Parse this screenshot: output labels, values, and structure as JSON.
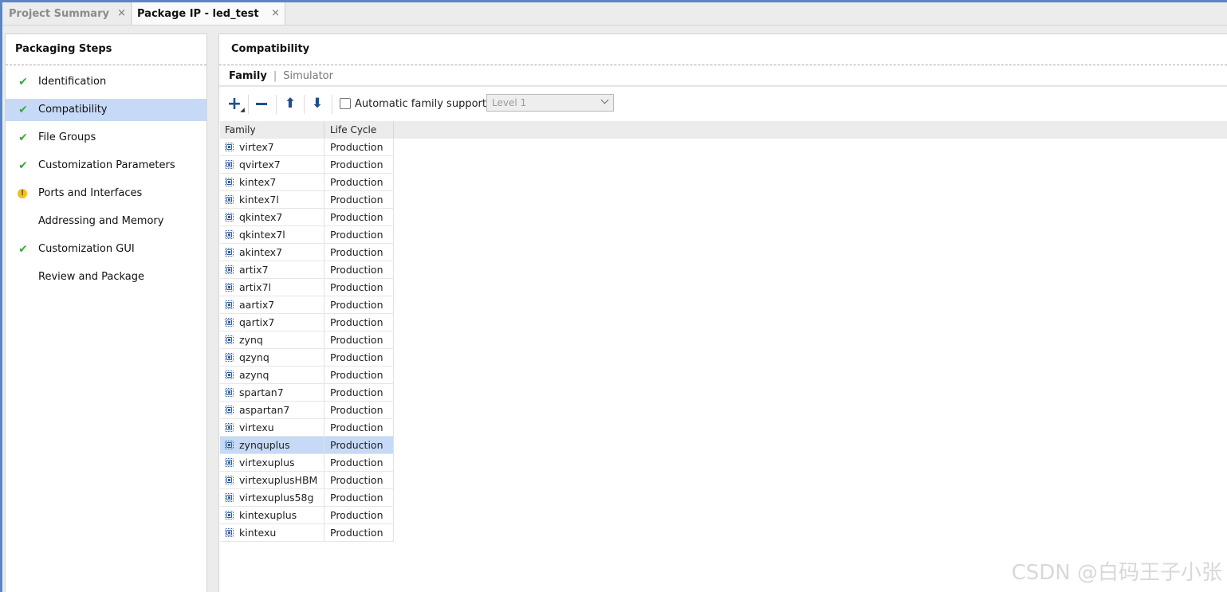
{
  "tabs": [
    {
      "label": "Project Summary",
      "active": false
    },
    {
      "label": "Package IP - led_test",
      "active": true
    }
  ],
  "tab_close_glyph": "×",
  "left_panel": {
    "title": "Packaging Steps",
    "steps": [
      {
        "label": "Identification",
        "status": "check-icon",
        "selected": false
      },
      {
        "label": "Compatibility",
        "status": "check-icon",
        "selected": true
      },
      {
        "label": "File Groups",
        "status": "check-icon",
        "selected": false
      },
      {
        "label": "Customization Parameters",
        "status": "check-icon",
        "selected": false
      },
      {
        "label": "Ports and Interfaces",
        "status": "warning-icon",
        "selected": false
      },
      {
        "label": "Addressing and Memory",
        "status": "none",
        "selected": false
      },
      {
        "label": "Customization GUI",
        "status": "check-icon",
        "selected": false
      },
      {
        "label": "Review and Package",
        "status": "none",
        "selected": false
      }
    ]
  },
  "main": {
    "title": "Compatibility",
    "subtabs": {
      "active": "Family",
      "inactive": "Simulator",
      "separator": "|"
    },
    "toolbar": {
      "buttons": [
        "add-icon",
        "remove-icon",
        "move-up-icon",
        "move-down-icon"
      ],
      "auto_family_label": "Automatic family support",
      "auto_family_checked": false,
      "level_select_value": "Level 1"
    },
    "table": {
      "columns": [
        "Family",
        "Life Cycle"
      ],
      "rows": [
        {
          "family": "virtex7",
          "life_cycle": "Production"
        },
        {
          "family": "qvirtex7",
          "life_cycle": "Production"
        },
        {
          "family": "kintex7",
          "life_cycle": "Production"
        },
        {
          "family": "kintex7l",
          "life_cycle": "Production"
        },
        {
          "family": "qkintex7",
          "life_cycle": "Production"
        },
        {
          "family": "qkintex7l",
          "life_cycle": "Production"
        },
        {
          "family": "akintex7",
          "life_cycle": "Production"
        },
        {
          "family": "artix7",
          "life_cycle": "Production"
        },
        {
          "family": "artix7l",
          "life_cycle": "Production"
        },
        {
          "family": "aartix7",
          "life_cycle": "Production"
        },
        {
          "family": "qartix7",
          "life_cycle": "Production"
        },
        {
          "family": "zynq",
          "life_cycle": "Production"
        },
        {
          "family": "qzynq",
          "life_cycle": "Production"
        },
        {
          "family": "azynq",
          "life_cycle": "Production"
        },
        {
          "family": "spartan7",
          "life_cycle": "Production"
        },
        {
          "family": "aspartan7",
          "life_cycle": "Production"
        },
        {
          "family": "virtexu",
          "life_cycle": "Production"
        },
        {
          "family": "zynquplus",
          "life_cycle": "Production",
          "selected": true
        },
        {
          "family": "virtexuplus",
          "life_cycle": "Production"
        },
        {
          "family": "virtexuplusHBM",
          "life_cycle": "Production"
        },
        {
          "family": "virtexuplus58g",
          "life_cycle": "Production"
        },
        {
          "family": "kintexuplus",
          "life_cycle": "Production"
        },
        {
          "family": "kintexu",
          "life_cycle": "Production"
        }
      ]
    }
  },
  "watermark": "CSDN @白码王子小张",
  "colors": {
    "accent": "#5b86c5",
    "selection": "#c6daf7",
    "check": "#3aa93a",
    "warning": "#f1c21b",
    "icon_blue": "#1f4f8f"
  }
}
